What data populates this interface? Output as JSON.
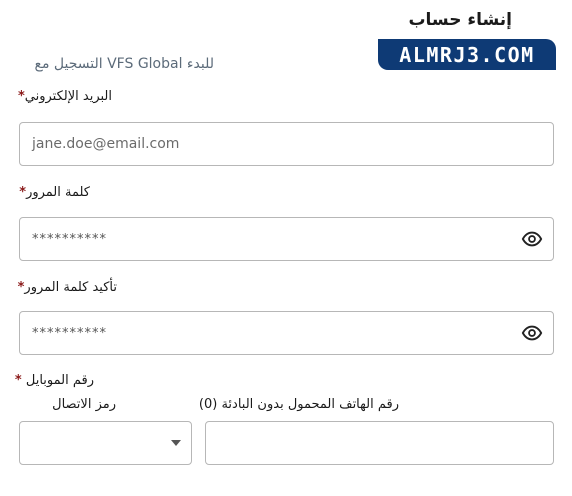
{
  "header": {
    "title": "إنشاء حساب",
    "subtitle": "للبدء VFS Global التسجيل مع"
  },
  "brand": {
    "label": "ALMRJ3.COM"
  },
  "form": {
    "email": {
      "label": "البريد الإلكتروني",
      "required_mark": "*",
      "value": "jane.doe@email.com"
    },
    "password": {
      "label": "كلمة المرور",
      "required_mark": "*",
      "value": "**********"
    },
    "confirm_password": {
      "label": "تأكيد كلمة المرور",
      "required_mark": "*",
      "value": "**********"
    },
    "mobile": {
      "label": "رقم الموبايل",
      "required_mark": "*",
      "dial_code_label": "رمز الاتصال",
      "dial_code_value": "",
      "phone_label": "رقم الهاتف المحمول بدون البادئة (0)",
      "phone_value": ""
    }
  },
  "icons": {
    "show_password": "eye-icon",
    "dropdown": "chevron-down-icon"
  }
}
